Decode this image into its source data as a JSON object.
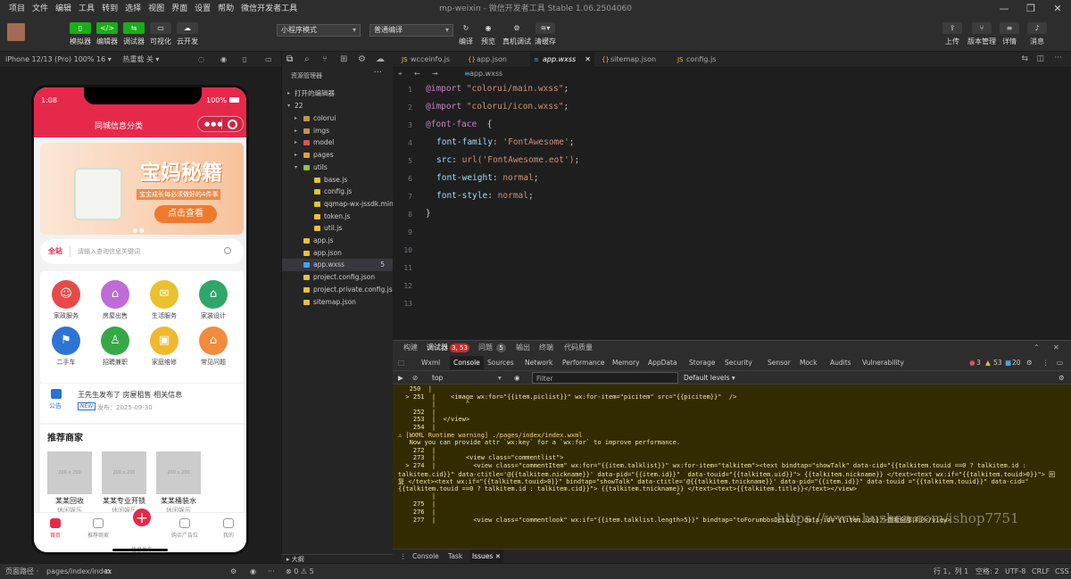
{
  "titlebar": {
    "menu": [
      "项目",
      "文件",
      "编辑",
      "工具",
      "转到",
      "选择",
      "视图",
      "界面",
      "设置",
      "帮助",
      "微信开发者工具"
    ],
    "title": "mp-weixin - 微信开发者工具 Stable 1.06.2504060"
  },
  "toolbar": {
    "left": [
      "模拟器",
      "编辑器",
      "调试器",
      "可视化",
      "云开发"
    ],
    "mode_select": "小程序模式",
    "compile_select": "普通编译",
    "mid": [
      "编译",
      "预览",
      "真机调试",
      "清缓存"
    ],
    "right": [
      "上传",
      "版本管理",
      "详情",
      "消息"
    ]
  },
  "simbar": {
    "device": "iPhone 12/13 (Pro) 100% 16 ▾",
    "hotreload": "热重载 关 ▾"
  },
  "phone": {
    "time": "1:08",
    "battery": "100%",
    "title": "同城信息分类",
    "banner_title": "宝妈秘籍",
    "banner_sub": "宝宝成长每必须做好的4件事",
    "banner_btn": "点击查看",
    "search_label": "全站",
    "search_placeholder": "请输入查询信息关键词",
    "grid": [
      {
        "t": "家政服务",
        "c": "#e84a4a",
        "i": "☺"
      },
      {
        "t": "房屋出售",
        "c": "#c06bd8",
        "i": "⌂"
      },
      {
        "t": "生活服务",
        "c": "#e9c22e",
        "i": "✉"
      },
      {
        "t": "家装设计",
        "c": "#2fa66a",
        "i": "⌂"
      },
      {
        "t": "二手车",
        "c": "#2e73d6",
        "i": "⚑"
      },
      {
        "t": "招聘兼职",
        "c": "#37a846",
        "i": "♙"
      },
      {
        "t": "家庭维修",
        "c": "#f0b92d",
        "i": "▣"
      },
      {
        "t": "常见问题",
        "c": "#f28b3c",
        "i": "⌂"
      }
    ],
    "notice_label": "公告",
    "notice_text": "王先生发布了 房屋租售 相关信息",
    "notice_badge": "NEW",
    "notice_date": "发布：2025-09-30",
    "recs_title": "推荐商家",
    "img_label": "200 x 200",
    "merchants": [
      {
        "n": "某某回收",
        "s": "休闲娱乐"
      },
      {
        "n": "某某专业开锁",
        "s": "休闲娱乐"
      },
      {
        "n": "某某桶装水",
        "s": "休闲娱乐"
      }
    ],
    "tabs": [
      "首页",
      "推荐商家",
      "信息发布",
      "购买广告位",
      "我的"
    ]
  },
  "explorer": {
    "header": "资源管理器",
    "open_editors": "打开的编辑器",
    "root": "22",
    "outline": "大纲",
    "files": [
      {
        "n": "colorui",
        "d": 1,
        "f": true,
        "c": "#c09553"
      },
      {
        "n": "imgs",
        "d": 1,
        "f": true,
        "c": "#c09553"
      },
      {
        "n": "model",
        "d": 1,
        "f": true,
        "c": "#e05252"
      },
      {
        "n": "pages",
        "d": 1,
        "f": true,
        "c": "#e0a040"
      },
      {
        "n": "utils",
        "d": 1,
        "f": true,
        "c": "#8bc34a",
        "open": true
      },
      {
        "n": "base.js",
        "d": 2,
        "c": "#e8c03a"
      },
      {
        "n": "config.js",
        "d": 2,
        "c": "#e8c03a"
      },
      {
        "n": "qqmap-wx-jssdk.min.js",
        "d": 2,
        "c": "#e8c03a"
      },
      {
        "n": "token.js",
        "d": 2,
        "c": "#e8c03a"
      },
      {
        "n": "util.js",
        "d": 2,
        "c": "#e8c03a"
      },
      {
        "n": "app.js",
        "d": 1,
        "c": "#e8c03a"
      },
      {
        "n": "app.json",
        "d": 1,
        "c": "#e8c03a"
      },
      {
        "n": "app.wxss",
        "d": 1,
        "c": "#4aa0e8",
        "badge": "5",
        "sel": true
      },
      {
        "n": "project.config.json",
        "d": 1,
        "c": "#e8c03a"
      },
      {
        "n": "project.private.config.js...",
        "d": 1,
        "c": "#e8c03a"
      },
      {
        "n": "sitemap.json",
        "d": 1,
        "c": "#e8c03a"
      }
    ]
  },
  "editor": {
    "tabs": [
      "wcceinfo.js",
      "app.json",
      "app.wxss",
      "sitemap.json",
      "config.js"
    ],
    "breadcrumb": "app.wxss",
    "lines": [
      {
        "n": "1",
        "k": "@import",
        "s": "\"colorui/main.wxss\"",
        "e": ";"
      },
      {
        "n": "2",
        "k": "@import",
        "s": "\"colorui/icon.wxss\"",
        "e": ";"
      },
      {
        "n": "3",
        "k": "@font-face",
        "s": "",
        "e": " {"
      },
      {
        "n": "4",
        "p": "font-family",
        "v": "'FontAwesome'"
      },
      {
        "n": "5",
        "p": "src",
        "v": "url('FontAwesome.eot')"
      },
      {
        "n": "6",
        "p": "font-weight",
        "v": "normal"
      },
      {
        "n": "7",
        "p": "font-style",
        "v": "normal"
      },
      {
        "n": "8",
        "w": "}"
      },
      {
        "n": "9"
      },
      {
        "n": "10"
      },
      {
        "n": "11"
      },
      {
        "n": "12"
      },
      {
        "n": "13"
      }
    ]
  },
  "devtools": {
    "top": [
      "构建",
      "调试器",
      "问题",
      "输出",
      "终端",
      "代码质量"
    ],
    "err_badge": "3, 53",
    "issue_badge": "5",
    "tabs": [
      "Wxml",
      "Console",
      "Sources",
      "Network",
      "Performance",
      "Memory",
      "AppData",
      "Storage",
      "Security",
      "Sensor",
      "Mock",
      "Audits",
      "Vulnerability"
    ],
    "counts": {
      "err": "3",
      "warn": "53",
      "info": "20"
    },
    "context": "top",
    "filter_placeholder": "Filter",
    "levels": "Default levels",
    "console_lines": [
      "   250  |",
      "  > 251  |    <image wx:for=\"{{item.piclist}}\" wx:for-item=\"picitem\" src=\"{{picitem}}\"  />",
      "         |        ^",
      "    252  |",
      "    253  |  </view>",
      "    254  |",
      "⚠ [WXML Runtime warning] ./pages/index/index.wxml",
      "   Now you can provide attr `wx:key` for a `wx:for` to improve performance.",
      "    272  |",
      "    273  |        <view class=\"commentlist\">",
      "  > 274  |          <view class=\"commentItem\" wx:for=\"{{item.talklist}}\" wx:for-item=\"talkitem\"><text bindtap=\"showTalk\" data-cid=\"{{talkitem.touid ==0 ? talkitem.id :",
      "talkitem.cid}}\" data-ctitle='@{{talkitem.nickname}}' data-pid=\"{{item.id}}\"  data-touid=\"{{talkitem.uid}}\"> {{talkitem.nickname}} </text><text wx:if=\"{{talkitem.touid>0}}\"> 回",
      "复 </text><text wx:if=\"{{talkitem.touid>0}}\" bindtap=\"showTalk\" data-ctitle='@{{talkitem.tnickname}}' data-pid=\"{{item.id}}\" data-touid =\"{{talkitem.touid}}\" data-cid=\"",
      "{{talkitem.touid ==0 ? talkitem.id : talkitem.cid}}\"> {{talkitem.tnickname}} </text><text>{{talkitem.title}}</text></view>",
      "         |                                                                ^",
      "    275  |",
      "    276  |",
      "    277  |          <view class=\"commentlook\" wx:if=\"{{item.talklist.length>5}}\" bindtap=\"toForumbbsDetail\" data-id=\"{{item.id}}\">查看全部评论</view>"
    ],
    "bottom_tabs": [
      "Console",
      "Task",
      "Issues"
    ]
  },
  "statusbar": {
    "path_label": "页面路径 ·",
    "path": "pages/index/index",
    "problems": "⊗ 0 ⚠ 5",
    "position": "行 1，列 1",
    "spaces": "空格: 2",
    "encoding": "UTF-8",
    "eol": "CRLF",
    "lang": "CSS"
  },
  "watermark": "https://www.huzhan.com/ishop7751"
}
